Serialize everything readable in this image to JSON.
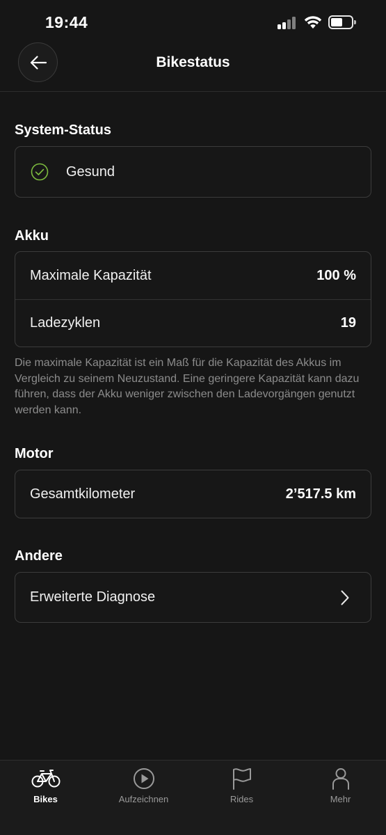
{
  "status_bar": {
    "time": "19:44"
  },
  "header": {
    "title": "Bikestatus"
  },
  "system_status": {
    "title": "System-Status",
    "status_text": "Gesund",
    "status_color": "#7dbb3f"
  },
  "akku": {
    "title": "Akku",
    "rows": [
      {
        "label": "Maximale Kapazität",
        "value": "100 %"
      },
      {
        "label": "Ladezyklen",
        "value": "19"
      }
    ],
    "note": "Die maximale Kapazität ist ein Maß für die Kapazität des Akkus im Vergleich zu seinem Neuzustand. Eine geringere Kapazität kann dazu führen, dass der Akku weniger zwischen den Ladevorgängen genutzt werden kann."
  },
  "motor": {
    "title": "Motor",
    "rows": [
      {
        "label": "Gesamtkilometer",
        "value": "2’517.5 km"
      }
    ]
  },
  "andere": {
    "title": "Andere",
    "rows": [
      {
        "label": "Erweiterte Diagnose",
        "icon": "chevron-right-icon"
      }
    ]
  },
  "tabbar": {
    "tabs": [
      {
        "label": "Bikes",
        "icon": "bike-icon",
        "active": true
      },
      {
        "label": "Aufzeichnen",
        "icon": "record-play-icon",
        "active": false
      },
      {
        "label": "Rides",
        "icon": "flag-icon",
        "active": false
      },
      {
        "label": "Mehr",
        "icon": "person-icon",
        "active": false
      }
    ]
  }
}
